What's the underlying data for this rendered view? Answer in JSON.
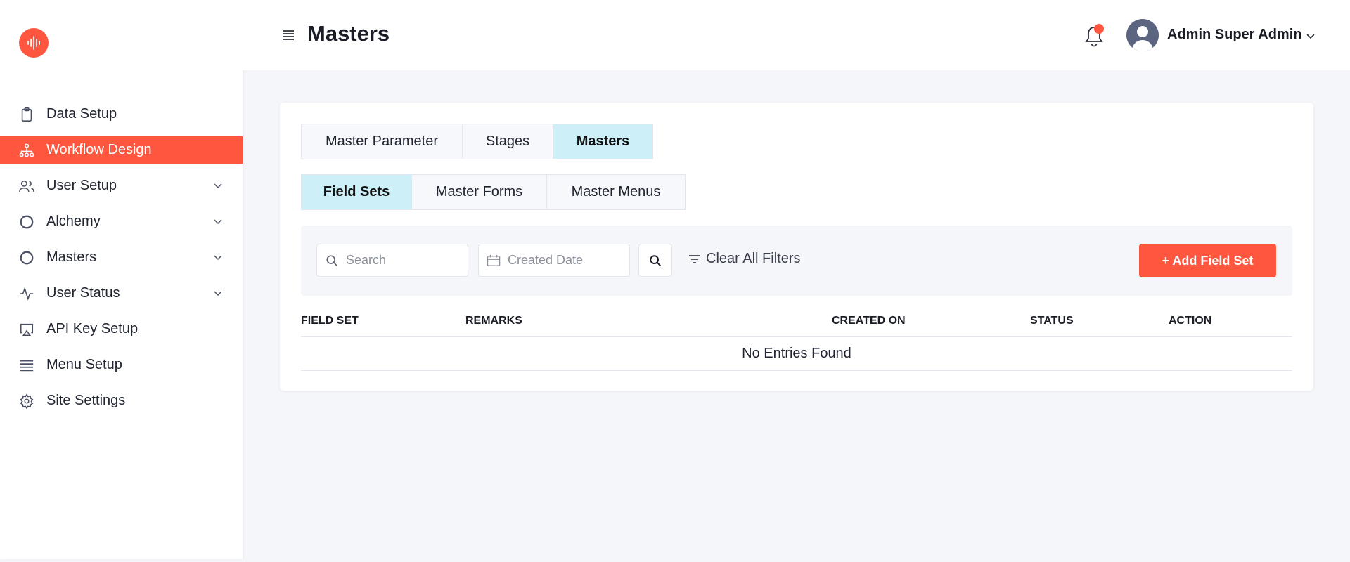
{
  "sidebar": {
    "items": [
      {
        "label": "Data Setup",
        "icon": "clipboard-icon",
        "active": false,
        "has_chevron": false
      },
      {
        "label": "Workflow Design",
        "icon": "sitemap-icon",
        "active": true,
        "has_chevron": false
      },
      {
        "label": "User Setup",
        "icon": "users-icon",
        "active": false,
        "has_chevron": true
      },
      {
        "label": "Alchemy",
        "icon": "circle-icon",
        "active": false,
        "has_chevron": true
      },
      {
        "label": "Masters",
        "icon": "circle-icon",
        "active": false,
        "has_chevron": true
      },
      {
        "label": "User Status",
        "icon": "activity-icon",
        "active": false,
        "has_chevron": true
      },
      {
        "label": "API Key Setup",
        "icon": "airplay-icon",
        "active": false,
        "has_chevron": false
      },
      {
        "label": "Menu Setup",
        "icon": "list-icon",
        "active": false,
        "has_chevron": false
      },
      {
        "label": "Site Settings",
        "icon": "gear-icon",
        "active": false,
        "has_chevron": false
      }
    ]
  },
  "header": {
    "title": "Masters",
    "user_name": "Admin Super Admin"
  },
  "tabs_primary": [
    {
      "label": "Master Parameter",
      "active": false
    },
    {
      "label": "Stages",
      "active": false
    },
    {
      "label": "Masters",
      "active": true
    }
  ],
  "tabs_secondary": [
    {
      "label": "Field Sets",
      "active": true
    },
    {
      "label": "Master Forms",
      "active": false
    },
    {
      "label": "Master Menus",
      "active": false
    }
  ],
  "filters": {
    "search_placeholder": "Search",
    "date_placeholder": "Created Date",
    "clear_label": "Clear All Filters",
    "add_label": "+ Add Field Set"
  },
  "table": {
    "columns": [
      "FIELD SET",
      "REMARKS",
      "CREATED ON",
      "STATUS",
      "ACTION"
    ],
    "empty_text": "No Entries Found"
  },
  "colors": {
    "accent": "#ff5640",
    "tab_active": "#cdeff8",
    "background": "#f4f6fa"
  }
}
